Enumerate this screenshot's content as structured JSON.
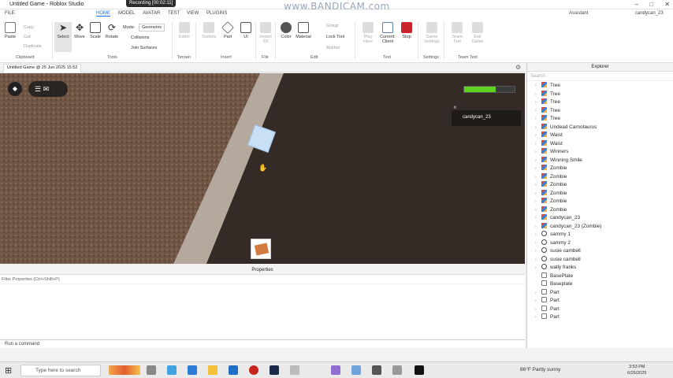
{
  "window": {
    "title": "Untitled Game - Roblox Studio",
    "recording": "Recording [00:02:11]",
    "watermark": "www.BANDICAM.com",
    "controls": [
      "–",
      "□",
      "✕"
    ]
  },
  "menubar": {
    "file": "FILE",
    "tabs": [
      "HOME",
      "MODEL",
      "AVATAR",
      "TEST",
      "VIEW",
      "PLUGINS"
    ],
    "assistant": "Assistant",
    "user": "candycan_23"
  },
  "ribbon": {
    "clipboard": {
      "paste": "Paste",
      "copy": "Copy",
      "cut": "Cut",
      "duplicate": "Duplicate",
      "label": "Clipboard"
    },
    "tools": {
      "select": "Select",
      "move": "Move",
      "scale": "Scale",
      "rotate": "Rotate",
      "label": "Tools"
    },
    "mode": {
      "label": "Mode:",
      "value": "Geometric",
      "collisions": "Collisions",
      "join": "Join Surfaces"
    },
    "terrain": {
      "editor": "Editor",
      "label": "Terrain"
    },
    "insert": {
      "toolbox": "Toolbox",
      "part": "Part",
      "ui": "UI",
      "label": "Insert"
    },
    "file": {
      "import": "Import 3D",
      "label": "File"
    },
    "edit": {
      "color": "Color",
      "material": "Material",
      "group": "Group",
      "lock": "Lock Tool",
      "anchor": "Anchor",
      "label": "Edit"
    },
    "test": {
      "play": "Play Here",
      "current": "Current: Client",
      "stop": "Stop",
      "label": "Test"
    },
    "settings": {
      "game": "Game Settings",
      "label": "Settings"
    },
    "teamtest": {
      "team": "Team Test",
      "exit": "Exit Game",
      "label": "Team Test"
    }
  },
  "doc_tab": "Untitled Game @ 25 Jun 2025 15:52",
  "viewport": {
    "player_name": "candycan_23",
    "health": 0.62
  },
  "properties": {
    "title": "Properties",
    "filter": "Filter Properties (Ctrl+Shift+P)"
  },
  "command_bar": "Run a command",
  "explorer": {
    "title": "Explorer",
    "search": "Search",
    "items": [
      {
        "label": "Tree",
        "icon": "model"
      },
      {
        "label": "Tree",
        "icon": "model"
      },
      {
        "label": "Tree",
        "icon": "model"
      },
      {
        "label": "Tree",
        "icon": "model"
      },
      {
        "label": "Tree",
        "icon": "model"
      },
      {
        "label": "Undead Carnotaurus",
        "icon": "model"
      },
      {
        "label": "Waist",
        "icon": "model"
      },
      {
        "label": "Waist",
        "icon": "model"
      },
      {
        "label": "Winners",
        "icon": "model"
      },
      {
        "label": "Winning Smile",
        "icon": "model"
      },
      {
        "label": "Zombie",
        "icon": "model"
      },
      {
        "label": "Zombie",
        "icon": "model"
      },
      {
        "label": "Zombie",
        "icon": "model"
      },
      {
        "label": "Zombie",
        "icon": "model"
      },
      {
        "label": "Zombie",
        "icon": "model"
      },
      {
        "label": "Zombie",
        "icon": "model"
      },
      {
        "label": "candycan_23",
        "icon": "model"
      },
      {
        "label": "candycan_23 (Zombie)",
        "icon": "model"
      },
      {
        "label": "sammy 1",
        "icon": "player"
      },
      {
        "label": "sammy 2",
        "icon": "player"
      },
      {
        "label": "susie cambell",
        "icon": "player"
      },
      {
        "label": "susie cambell",
        "icon": "player"
      },
      {
        "label": "wally franks",
        "icon": "player"
      },
      {
        "label": "BasePlate",
        "icon": "part"
      },
      {
        "label": "Baseplate",
        "icon": "part"
      },
      {
        "label": "Part",
        "icon": "part"
      },
      {
        "label": "Part",
        "icon": "part"
      },
      {
        "label": "Part",
        "icon": "part"
      },
      {
        "label": "Part",
        "icon": "part"
      }
    ]
  },
  "taskbar": {
    "search": "Type here to search",
    "weather": "86°F  Partly sunny",
    "time": "3:53 PM",
    "date": "6/25/2025"
  }
}
